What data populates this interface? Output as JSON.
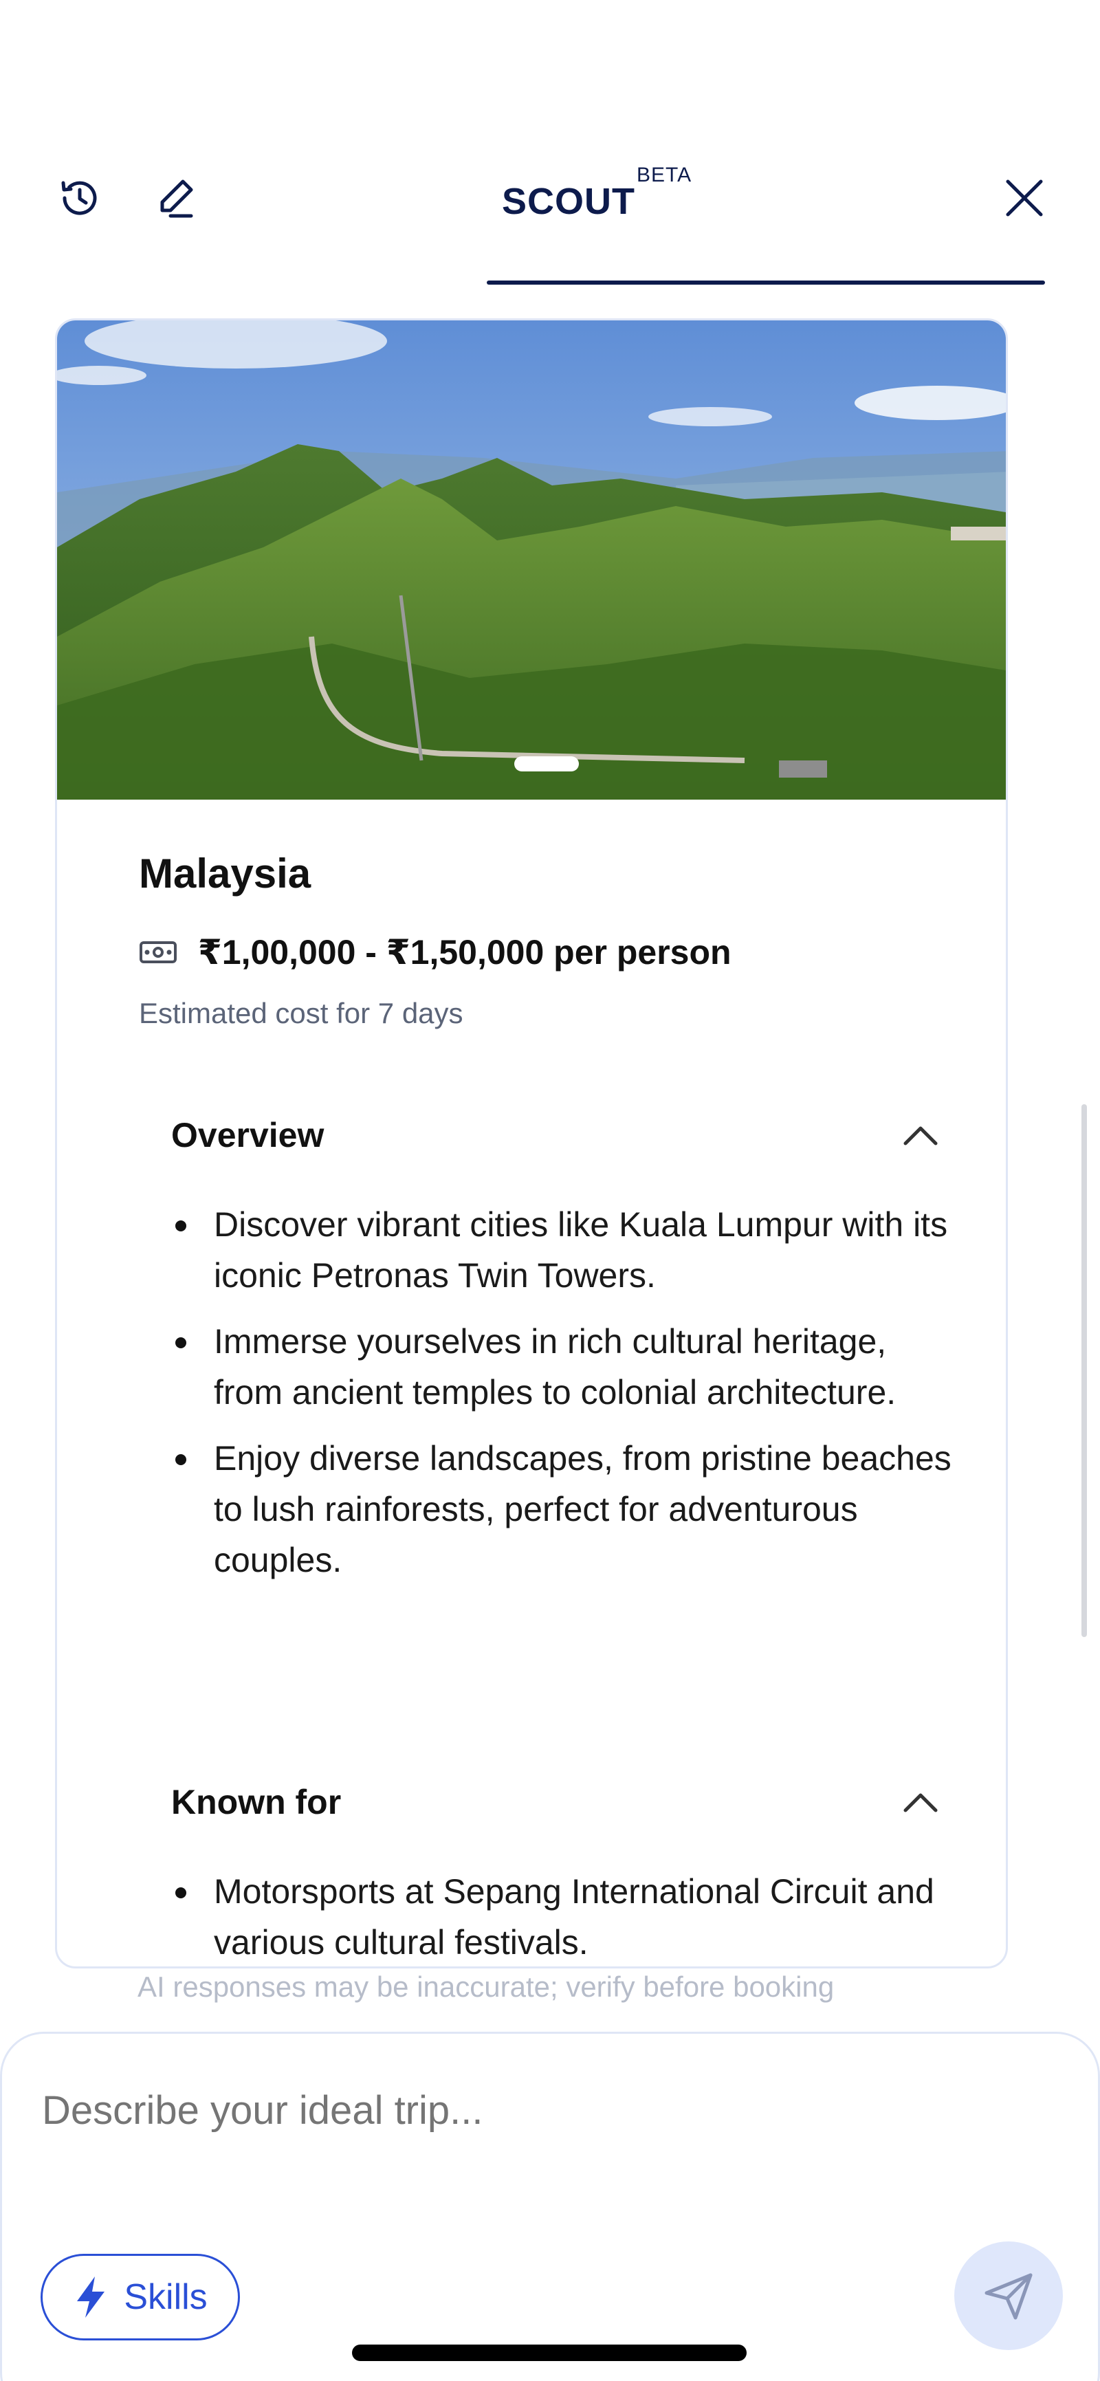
{
  "header": {
    "title": "SCOUT",
    "title_badge": "BETA",
    "icons": {
      "history": "history-icon",
      "edit": "edit-icon",
      "close": "close-icon"
    },
    "accent_color": "#0d1b4c"
  },
  "destination_card": {
    "image_alt": "Mountain landscape with suspension bridge",
    "name": "Malaysia",
    "price": "₹1,00,000 - ₹1,50,000 per person",
    "price_note": "Estimated cost for 7 days",
    "sections": {
      "overview": {
        "title": "Overview",
        "items": [
          "Discover vibrant cities like Kuala Lumpur with its iconic Petronas Twin Towers.",
          "Immerse yourselves in rich cultural heritage, from ancient temples to colonial architecture.",
          "Enjoy diverse landscapes, from pristine beaches to lush rainforests, perfect for adventurous couples."
        ]
      },
      "known_for": {
        "title": "Known for",
        "items": [
          "Motorsports at Sepang International Circuit and various cultural festivals."
        ]
      }
    }
  },
  "disclaimer": "AI responses may be inaccurate; verify before booking",
  "composer": {
    "placeholder": "Describe your ideal trip...",
    "skills_label": "Skills",
    "accent_color": "#2a4fd6"
  }
}
